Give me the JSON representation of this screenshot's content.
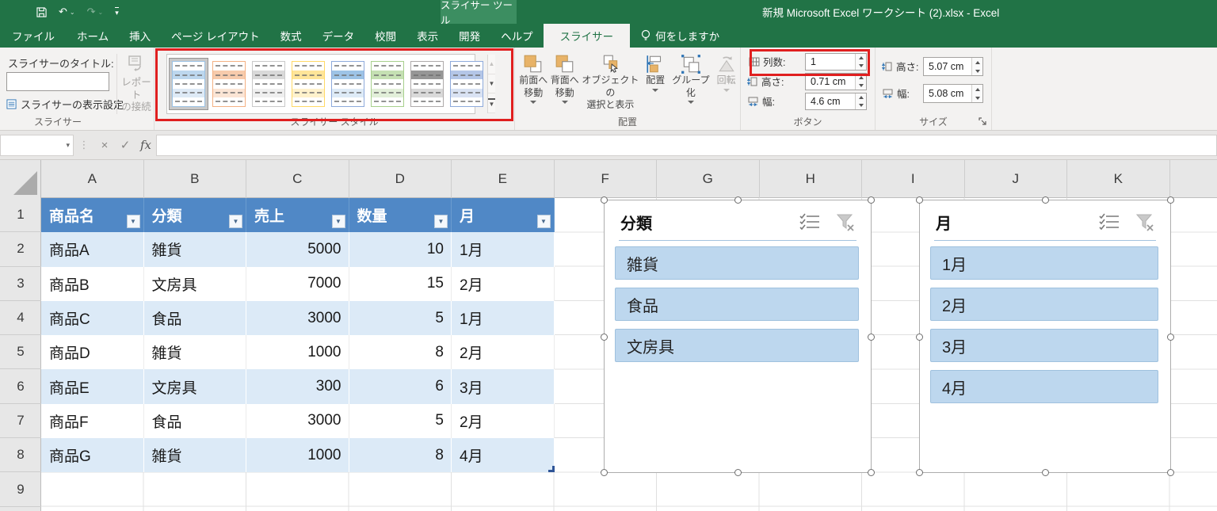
{
  "colors": {
    "excel_green": "#217346",
    "contextual_green": "#3c8e61",
    "table_header_blue": "#5088c6",
    "table_band_blue": "#dceaf7",
    "slicer_button_blue": "#bdd7ee",
    "highlight_red": "#e01f1f"
  },
  "title_bar": {
    "contextual_group": "スライサー ツール",
    "title": "新規 Microsoft Excel ワークシート (2).xlsx  -  Excel"
  },
  "tabs": {
    "items": [
      "ファイル",
      "ホーム",
      "挿入",
      "ページ レイアウト",
      "数式",
      "データ",
      "校閲",
      "表示",
      "開発",
      "ヘルプ",
      "スライサー"
    ],
    "active": "スライサー",
    "tell_me": "何をしますか"
  },
  "ribbon": {
    "slicer_group": {
      "name": "スライサー",
      "caption_label": "スライサーのタイトル:",
      "caption_value": "",
      "display_settings": "スライサーの表示設定",
      "report_connections_line1": "レポート",
      "report_connections_line2": "の接続"
    },
    "styles_group": {
      "name": "スライサー スタイル",
      "styles": [
        {
          "selected": true,
          "colors": {
            "--hd": "#bdd7ee",
            "--bn": "#deeaf6",
            "--bd": "#9cc3e5"
          }
        },
        {
          "selected": false,
          "colors": {
            "--hd": "#f7cbac",
            "--bn": "#fbe5d5",
            "--bd": "#f4b183"
          }
        },
        {
          "selected": false,
          "colors": {
            "--hd": "#d9d9d9",
            "--bn": "#efefef",
            "--bd": "#c9c9c9"
          }
        },
        {
          "selected": false,
          "colors": {
            "--hd": "#ffe599",
            "--bn": "#fff2cc",
            "--bd": "#ffd966"
          }
        },
        {
          "selected": false,
          "colors": {
            "--hd": "#9dc3e6",
            "--bn": "#deebf7",
            "--bd": "#8eaadb"
          }
        },
        {
          "selected": false,
          "colors": {
            "--hd": "#c5e0b3",
            "--bn": "#e2efd9",
            "--bd": "#a8d08d"
          }
        },
        {
          "selected": false,
          "colors": {
            "--hd": "#969696",
            "--bn": "#d9d9d9",
            "--bd": "#aeaaaa"
          }
        },
        {
          "selected": false,
          "colors": {
            "--hd": "#b4c6e7",
            "--bn": "#d9e2f3",
            "--bd": "#8eaadb"
          }
        }
      ]
    },
    "arrange_group": {
      "name": "配置",
      "buttons": [
        {
          "line1": "前面へ",
          "line2": "移動"
        },
        {
          "line1": "背面へ",
          "line2": "移動"
        },
        {
          "line1": "オブジェクトの",
          "line2": "選択と表示"
        },
        {
          "line1": "配置",
          "line2": ""
        },
        {
          "line1": "グループ化",
          "line2": ""
        },
        {
          "line1": "回転",
          "line2": ""
        }
      ]
    },
    "buttons_group": {
      "name": "ボタン",
      "columns_label": "列数:",
      "columns_value": "1",
      "height_label": "高さ:",
      "height_value": "0.71 cm",
      "width_label": "幅:",
      "width_value": "4.6 cm"
    },
    "size_group": {
      "name": "サイズ",
      "height_label": "高さ:",
      "height_value": "5.07 cm",
      "width_label": "幅:",
      "width_value": "5.08 cm"
    }
  },
  "formula_bar": {
    "name_box": "",
    "fx_label": "fx",
    "formula": ""
  },
  "grid": {
    "columns": [
      "A",
      "B",
      "C",
      "D",
      "E",
      "F",
      "G",
      "H",
      "I",
      "J",
      "K"
    ],
    "rows": [
      "1",
      "2",
      "3",
      "4",
      "5",
      "6",
      "7",
      "8",
      "9"
    ]
  },
  "table": {
    "headers": [
      "商品名",
      "分類",
      "売上",
      "数量",
      "月"
    ],
    "rows": [
      [
        "商品A",
        "雑貨",
        "5000",
        "10",
        "1月"
      ],
      [
        "商品B",
        "文房具",
        "7000",
        "15",
        "2月"
      ],
      [
        "商品C",
        "食品",
        "3000",
        "5",
        "1月"
      ],
      [
        "商品D",
        "雑貨",
        "1000",
        "8",
        "2月"
      ],
      [
        "商品E",
        "文房具",
        "300",
        "6",
        "3月"
      ],
      [
        "商品F",
        "食品",
        "3000",
        "5",
        "2月"
      ],
      [
        "商品G",
        "雑貨",
        "1000",
        "8",
        "4月"
      ]
    ]
  },
  "slicers": [
    {
      "title": "分類",
      "items": [
        "雑貨",
        "食品",
        "文房具"
      ]
    },
    {
      "title": "月",
      "items": [
        "1月",
        "2月",
        "3月",
        "4月"
      ]
    }
  ]
}
